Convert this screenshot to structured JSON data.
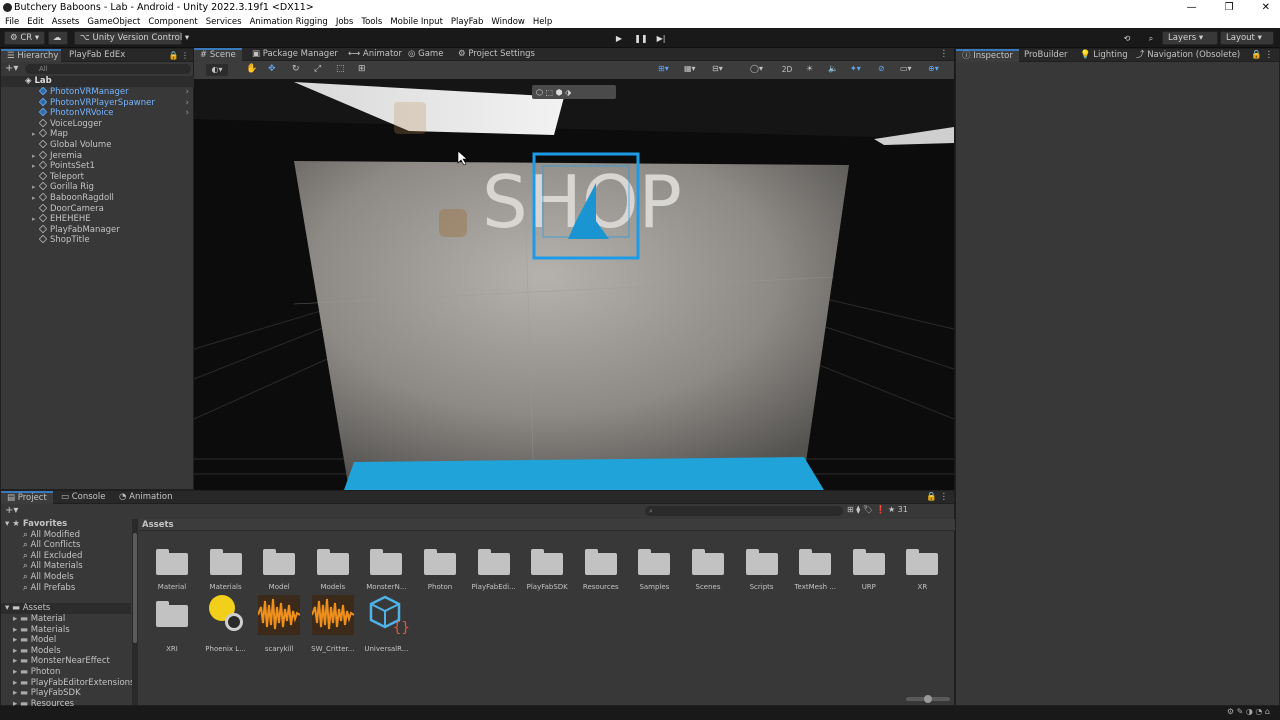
{
  "window": {
    "title": "Butchery Baboons - Lab - Android - Unity 2022.3.19f1 <DX11>"
  },
  "menu": [
    "File",
    "Edit",
    "Assets",
    "GameObject",
    "Component",
    "Services",
    "Animation Rigging",
    "Jobs",
    "Tools",
    "Mobile Input",
    "PlayFab",
    "Window",
    "Help"
  ],
  "toolbar": {
    "account": "CR",
    "vcs": "Unity Version Control",
    "layers": "Layers",
    "layout": "Layout"
  },
  "hierarchy": {
    "tabs": [
      "Hierarchy",
      "PlayFab EdEx"
    ],
    "search_placeholder": "All",
    "scene": "Lab",
    "items": [
      {
        "label": "PhotonVRManager",
        "blue": true,
        "arrow": true
      },
      {
        "label": "PhotonVRPlayerSpawner",
        "blue": true,
        "arrow": true
      },
      {
        "label": "PhotonVRVoice",
        "blue": true,
        "arrow": true
      },
      {
        "label": "VoiceLogger",
        "blue": false,
        "caret": false
      },
      {
        "label": "Map",
        "blue": false,
        "caret": true
      },
      {
        "label": "Global Volume",
        "blue": false,
        "caret": false
      },
      {
        "label": "Jeremia",
        "blue": false,
        "caret": true
      },
      {
        "label": "PointsSet1",
        "blue": false,
        "caret": true
      },
      {
        "label": "Teleport",
        "blue": false,
        "caret": false
      },
      {
        "label": "Gorilla Rig",
        "blue": false,
        "caret": true
      },
      {
        "label": "BaboonRagdoll",
        "blue": false,
        "caret": true
      },
      {
        "label": "DoorCamera",
        "blue": false,
        "caret": false
      },
      {
        "label": "EHEHEHE",
        "blue": false,
        "caret": true
      },
      {
        "label": "PlayFabManager",
        "blue": false,
        "caret": false
      },
      {
        "label": "ShopTitle",
        "blue": false,
        "caret": false
      }
    ]
  },
  "scene": {
    "tabs": [
      "Scene",
      "Package Manager",
      "Animator",
      "Game",
      "Project Settings"
    ],
    "mode_2d": "2D",
    "sign_text": "SHOP"
  },
  "inspector": {
    "tabs": [
      "Inspector",
      "ProBuilder",
      "Lighting",
      "Navigation (Obsolete)"
    ]
  },
  "project": {
    "tabs": [
      "Project",
      "Console",
      "Animation"
    ],
    "favorites_label": "Favorites",
    "favorites": [
      "All Modified",
      "All Conflicts",
      "All Excluded",
      "All Materials",
      "All Models",
      "All Prefabs"
    ],
    "assets_label": "Assets",
    "asset_tree": [
      "Material",
      "Materials",
      "Model",
      "Models",
      "MonsterNearEffect",
      "Photon",
      "PlayFabEditorExtensions",
      "PlayFabSDK",
      "Resources"
    ],
    "breadcrumb": "Assets",
    "hidden_count": "31",
    "grid_row1": [
      "Material",
      "Materials",
      "Model",
      "Models",
      "MonsterN...",
      "Photon",
      "PlayFabEdi...",
      "PlayFabSDK",
      "Resources",
      "Samples",
      "Scenes",
      "Scripts",
      "TextMesh ...",
      "URP",
      "XR"
    ],
    "grid_row2": [
      {
        "label": "XRI",
        "kind": "folder"
      },
      {
        "label": "Phoenix L...",
        "kind": "lighting"
      },
      {
        "label": "scarykill",
        "kind": "audio"
      },
      {
        "label": "SW_Critter...",
        "kind": "audio"
      },
      {
        "label": "UniversalR...",
        "kind": "script"
      }
    ]
  },
  "colors": {
    "accent": "#3a79bb",
    "prefab_blue": "#75b5ff",
    "audio_orange": "#f0901c",
    "floor_cyan": "#21a6d6"
  }
}
